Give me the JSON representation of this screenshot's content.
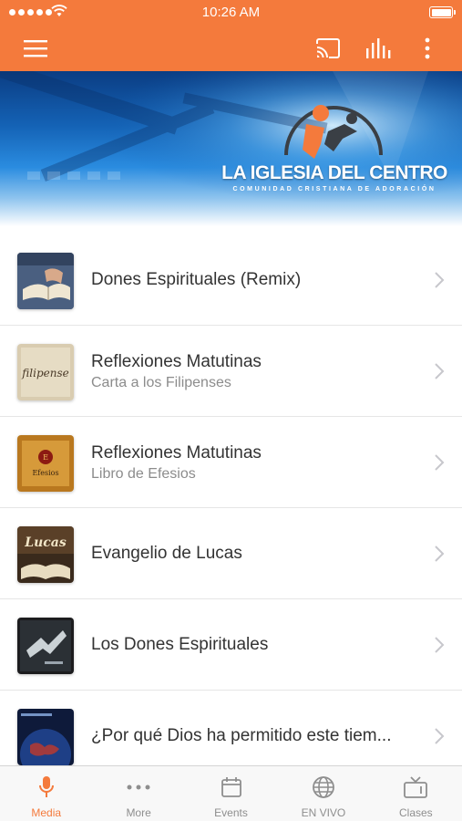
{
  "status_bar": {
    "time": "10:26 AM"
  },
  "app_bar": {
    "menu_icon": "hamburger-menu-icon",
    "cast_icon": "cast-icon",
    "audio_icon": "audio-bars-icon",
    "more_icon": "vertical-dots-icon",
    "color": "#f47a3c"
  },
  "banner": {
    "brand_name": "LA IGLESIA DEL CENTRO",
    "brand_subtitle": "COMUNIDAD CRISTIANA DE ADORACIÓN"
  },
  "media_list": [
    {
      "title": "Dones Espirituales (Remix)",
      "subtitle": "",
      "thumb_text": ""
    },
    {
      "title": "Reflexiones Matutinas",
      "subtitle": "Carta a los Filipenses",
      "thumb_text": "filipense"
    },
    {
      "title": "Reflexiones Matutinas",
      "subtitle": "Libro de Efesios",
      "thumb_text": "Efesios"
    },
    {
      "title": "Evangelio de Lucas",
      "subtitle": "",
      "thumb_text": "Lucas"
    },
    {
      "title": "Los Dones Espirituales",
      "subtitle": "",
      "thumb_text": ""
    },
    {
      "title": "¿Por qué Dios ha permitido este tiem...",
      "subtitle": "",
      "thumb_text": ""
    }
  ],
  "tabs": [
    {
      "label": "Media",
      "icon": "microphone-icon",
      "active": true
    },
    {
      "label": "More",
      "icon": "ellipsis-icon",
      "active": false
    },
    {
      "label": "Events",
      "icon": "calendar-icon",
      "active": false
    },
    {
      "label": "EN VIVO",
      "icon": "globe-icon",
      "active": false
    },
    {
      "label": "Clases",
      "icon": "tv-icon",
      "active": false
    }
  ],
  "colors": {
    "accent": "#f47a3c",
    "tab_inactive": "#8e8e8e"
  }
}
